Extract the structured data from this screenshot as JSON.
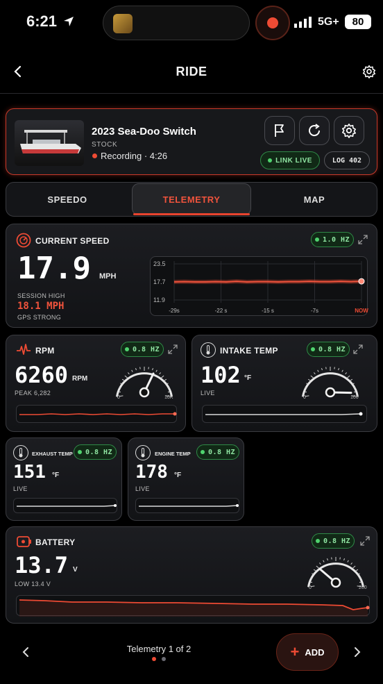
{
  "status_bar": {
    "time": "6:21",
    "network": "5G+",
    "battery": "80"
  },
  "header": {
    "title": "RIDE"
  },
  "vehicle": {
    "name": "2023 Sea-Doo Switch",
    "trim": "STOCK",
    "recording": "Recording · 4:26",
    "link_status": "LINK LIVE",
    "log": "LOG 402"
  },
  "tabs": [
    {
      "label": "SPEEDO"
    },
    {
      "label": "TELEMETRY"
    },
    {
      "label": "MAP"
    }
  ],
  "speed": {
    "title": "CURRENT SPEED",
    "rate": "1.0 HZ",
    "value": "17.9",
    "unit": "MPH",
    "session_high_label": "SESSION HIGH",
    "session_high_value": "18.1 MPH",
    "gps": "GPS STRONG",
    "chart": {
      "y_labels": [
        "23.5",
        "17.7",
        "11.9"
      ],
      "x_labels": [
        "-29s",
        "-22 s",
        "-15 s",
        "-7s",
        "NOW"
      ],
      "values": [
        17.7,
        17.8,
        17.7,
        17.7,
        17.8,
        17.7,
        17.9,
        17.7,
        17.8,
        17.8,
        17.7,
        17.8,
        17.8,
        17.9,
        17.8,
        17.8,
        17.9,
        17.8,
        17.9
      ]
    }
  },
  "rpm": {
    "title": "RPM",
    "rate": "0.8 HZ",
    "value": "6260",
    "unit": "RPM",
    "sub": "PEAK 6,282",
    "gauge_min": "0",
    "gauge_max": "10K",
    "gauge_level": 0.63
  },
  "intake": {
    "title": "INTAKE TEMP",
    "rate": "0.8 HZ",
    "value": "102",
    "unit": "°F",
    "sub": "LIVE",
    "gauge_min": "0",
    "gauge_max": "100",
    "gauge_level": 0.96
  },
  "exhaust": {
    "title": "EXHAUST TEMP",
    "rate": "0.8 HZ",
    "value": "151",
    "unit": "°F",
    "sub": "LIVE"
  },
  "engine": {
    "title": "ENGINE TEMP",
    "rate": "0.8 HZ",
    "value": "178",
    "unit": "°F",
    "sub": "LIVE"
  },
  "battery": {
    "title": "BATTERY",
    "rate": "0.8 HZ",
    "value": "13.7",
    "unit": "V",
    "sub": "LOW 13.4 V",
    "gauge_min": "0",
    "gauge_max": "200",
    "gauge_level": 0.25
  },
  "footer": {
    "page_label": "Telemetry 1 of 2",
    "add_label": "ADD"
  },
  "colors": {
    "accent": "#e8442e",
    "live_green": "#4fd36e",
    "panel": "#17181b"
  }
}
